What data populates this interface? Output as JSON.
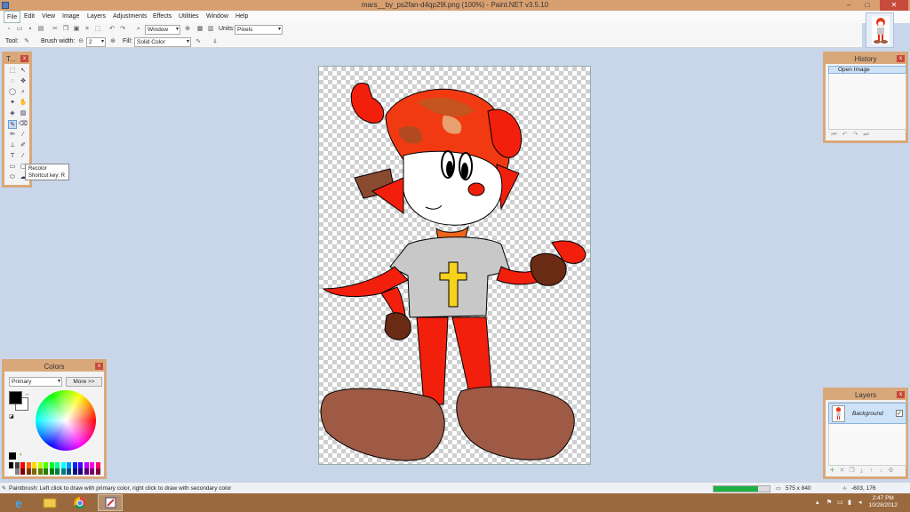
{
  "window": {
    "title": "mars__by_ps2fan-d4qp29l.png (100%) - Paint.NET v3.5.10",
    "minimize": "–",
    "maximize": "□",
    "close": "✕"
  },
  "menu": {
    "items": [
      "File",
      "Edit",
      "View",
      "Image",
      "Layers",
      "Adjustments",
      "Effects",
      "Utilities",
      "Window",
      "Help"
    ]
  },
  "toolbar": {
    "zoom_value": "Window",
    "units_label": "Units:",
    "units_value": "Pixels"
  },
  "toolbar2": {
    "tool_label": "Tool:",
    "brush_width_label": "Brush width:",
    "brush_width_value": "2",
    "fill_label": "Fill:",
    "fill_value": "Solid Color"
  },
  "tools_panel": {
    "title": "T...",
    "close": "x",
    "tooltip_title": "Recolor",
    "tooltip_shortcut": "Shortcut key: R"
  },
  "history_panel": {
    "title": "History",
    "close": "x",
    "items": [
      "Open Image"
    ]
  },
  "colors_panel": {
    "title": "Colors",
    "close": "x",
    "mode": "Primary",
    "more_button": "More >>",
    "primary_color": "#000000",
    "secondary_color": "#ffffff",
    "palette": [
      "#000000",
      "#404040",
      "#ff0000",
      "#ff6a00",
      "#ffd800",
      "#b6ff00",
      "#4cff00",
      "#00ff21",
      "#00ff90",
      "#00ffff",
      "#0094ff",
      "#0026ff",
      "#4800ff",
      "#b200ff",
      "#ff00dc",
      "#ff006e",
      "#ffffff",
      "#808080",
      "#7f0000",
      "#7f3300",
      "#7f6a00",
      "#5b7f00",
      "#267f00",
      "#007f0e",
      "#007f46",
      "#007f7f",
      "#004a7f",
      "#00137f",
      "#21007f",
      "#57007f",
      "#7f006e",
      "#7f0037"
    ]
  },
  "layers_panel": {
    "title": "Layers",
    "close": "x",
    "layers": [
      {
        "name": "Background",
        "visible": "✓"
      }
    ]
  },
  "status": {
    "hint": "Paintbrush: Left click to draw with primary color, right click to draw with secondary color",
    "progress_percent": 80,
    "image_size": "575 x 840",
    "cursor": "-603, 176"
  },
  "taskbar": {
    "time": "2:47 PM",
    "date": "10/28/2012"
  },
  "colors": {
    "titlebar": "#d8a070",
    "panel_border": "#d9a87a",
    "workspace": "#c9d6ea",
    "progress_fill": "#1fb045"
  }
}
